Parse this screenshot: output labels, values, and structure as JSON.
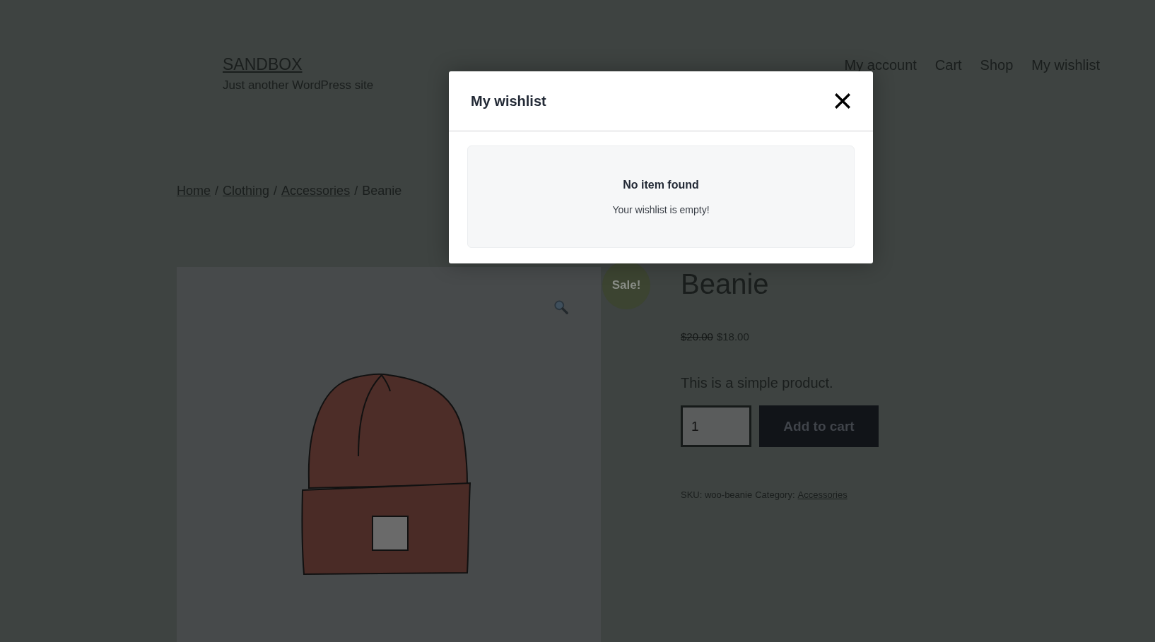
{
  "site": {
    "title": "SANDBOX",
    "tagline": "Just another WordPress site"
  },
  "nav": [
    "My account",
    "Cart",
    "Shop",
    "My wishlist"
  ],
  "breadcrumb": {
    "separator": "/",
    "items": [
      {
        "kind": "link",
        "label": "Home"
      },
      {
        "kind": "link",
        "label": "Clothing"
      },
      {
        "kind": "link",
        "label": "Accessories"
      },
      {
        "kind": "current",
        "label": "Beanie"
      }
    ]
  },
  "product": {
    "badge": "Sale!",
    "title": "Beanie",
    "regular_price": "$20.00",
    "sale_price": "$18.00",
    "description": "This is a simple product.",
    "quantity": "1",
    "add_to_cart": "Add to cart",
    "sku": "SKU: woo-beanie",
    "category_label": "Category:",
    "category": "Accessories"
  },
  "modal": {
    "title": "My wishlist",
    "empty_title": "No item found",
    "empty_message": "Your wishlist is empty!"
  }
}
